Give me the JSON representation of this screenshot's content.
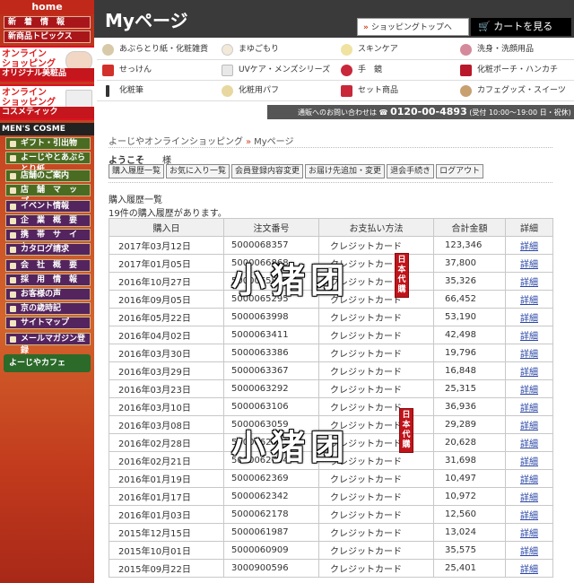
{
  "sidebar": {
    "home": "home",
    "red_items": [
      "新　着　情　報",
      "新商品トピックス"
    ],
    "banners": [
      {
        "top": "オンライン\nショッピング",
        "bottom": "オリジナル美粧品"
      },
      {
        "top": "オンライン\nショッピング",
        "bottom": "コスメティック"
      }
    ],
    "mens": "MEN'S COSME",
    "green_items": [
      "ギフト・引出物",
      "よーじやとあぶらとり紙",
      "店舗のご案内",
      "店　舗　マ　ッ　プ"
    ],
    "purple_items": [
      "イベント情報",
      "企　業　概　要",
      "携　帯　サ　イ　ト",
      "カタログ請求",
      "会　社　概　要",
      "採　用　情　報",
      "お客様の声",
      "京の歳時記",
      "サイトマップ",
      "メールマガジン登録"
    ],
    "cafe": "よーじやカフェ"
  },
  "header": {
    "title": "Myページ",
    "shop_top": "ショッピングトップへ",
    "cart": "カートを見る"
  },
  "categories": [
    {
      "label": "あぶらとり紙・化粧雑貨",
      "icon": "paper-icon",
      "color": "#d8c9a8"
    },
    {
      "label": "まゆごもり",
      "icon": "cocoon-icon",
      "color": "#f2e9d8"
    },
    {
      "label": "スキンケア",
      "icon": "skincare-icon",
      "color": "#f0e2a0"
    },
    {
      "label": "洗身・洗顔用品",
      "icon": "wash-icon",
      "color": "#d48a9a"
    },
    {
      "label": "せっけん",
      "icon": "soap-icon",
      "color": "#d2302a"
    },
    {
      "label": "UVケア・メンズシリーズ",
      "icon": "uv-icon",
      "color": "#e8e8e8"
    },
    {
      "label": "手　鏡",
      "icon": "mirror-icon",
      "color": "#c8283a"
    },
    {
      "label": "化粧ポーチ・ハンカチ",
      "icon": "pouch-icon",
      "color": "#b8182a"
    },
    {
      "label": "化粧筆",
      "icon": "brush-icon",
      "color": "#333333"
    },
    {
      "label": "化粧用パフ",
      "icon": "puff-icon",
      "color": "#e8d8a0"
    },
    {
      "label": "セット商品",
      "icon": "set-icon",
      "color": "#c8283a"
    },
    {
      "label": "カフェグッズ・スイーツ",
      "icon": "cafe-icon",
      "color": "#c8a070"
    }
  ],
  "contact": {
    "prefix": "通販へのお問い合わせは",
    "tel": "0120-00-4893",
    "hours": "(受付 10:00～19:00 日・祝休)"
  },
  "breadcrumb": {
    "home": "よーじやオンラインショッピング",
    "sep": "»",
    "current": "Myページ"
  },
  "welcome": {
    "text": "ようこそ",
    "sama": "様"
  },
  "tabs": [
    "購入履歴一覧",
    "お気に入り一覧",
    "会員登録内容変更",
    "お届け先追加・変更",
    "退会手続き",
    "ログアウト"
  ],
  "section_title": "購入履歴一覧",
  "count_text": "19件の購入履歴があります。",
  "table": {
    "headers": [
      "購入日",
      "注文番号",
      "お支払い方法",
      "合計金額",
      "詳細"
    ],
    "rows": [
      [
        "2017年03月12日",
        "5000068357",
        "クレジットカード",
        "123,346",
        "詳細"
      ],
      [
        "2017年01月05日",
        "5000066868",
        "クレジットカード",
        "37,800",
        "詳細"
      ],
      [
        "2016年10月27日",
        "5000065875",
        "クレジットカード",
        "35,326",
        "詳細"
      ],
      [
        "2016年09月05日",
        "5000065295",
        "クレジットカード",
        "66,452",
        "詳細"
      ],
      [
        "2016年05月22日",
        "5000063998",
        "クレジットカード",
        "53,190",
        "詳細"
      ],
      [
        "2016年04月02日",
        "5000063411",
        "クレジットカード",
        "42,498",
        "詳細"
      ],
      [
        "2016年03月30日",
        "5000063386",
        "クレジットカード",
        "19,796",
        "詳細"
      ],
      [
        "2016年03月29日",
        "5000063367",
        "クレジットカード",
        "16,848",
        "詳細"
      ],
      [
        "2016年03月23日",
        "5000063292",
        "クレジットカード",
        "25,315",
        "詳細"
      ],
      [
        "2016年03月10日",
        "5000063106",
        "クレジットカード",
        "36,936",
        "詳細"
      ],
      [
        "2016年03月08日",
        "5000063059",
        "クレジットカード",
        "29,289",
        "詳細"
      ],
      [
        "2016年02月28日",
        "5000062920",
        "クレジットカード",
        "20,628",
        "詳細"
      ],
      [
        "2016年02月21日",
        "5000062744",
        "クレジットカード",
        "31,698",
        "詳細"
      ],
      [
        "2016年01月19日",
        "5000062369",
        "クレジットカード",
        "10,497",
        "詳細"
      ],
      [
        "2016年01月17日",
        "5000062342",
        "クレジットカード",
        "10,972",
        "詳細"
      ],
      [
        "2016年01月03日",
        "5000062178",
        "クレジットカード",
        "12,560",
        "詳細"
      ],
      [
        "2015年12月15日",
        "5000061987",
        "クレジットカード",
        "13,024",
        "詳細"
      ],
      [
        "2015年10月01日",
        "5000060909",
        "クレジットカード",
        "35,575",
        "詳細"
      ],
      [
        "2015年09月22日",
        "3000900596",
        "クレジットカード",
        "25,401",
        "詳細"
      ]
    ]
  },
  "watermark": {
    "text": "小猪团",
    "seal": "日本代購"
  }
}
